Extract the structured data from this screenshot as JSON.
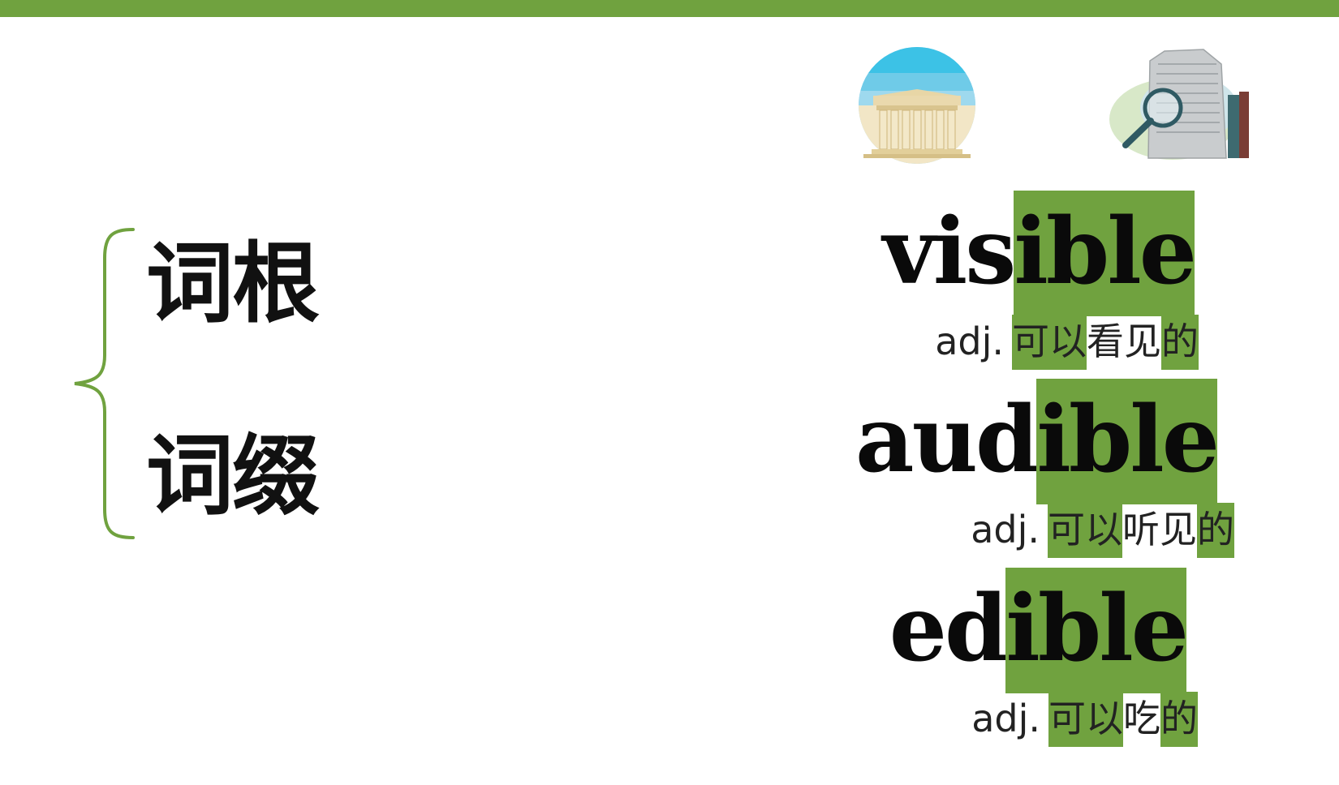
{
  "theme": {
    "accent": "#70a23f"
  },
  "left": {
    "root_term": "词根",
    "affix_term": "词缀"
  },
  "icons": {
    "first": "parthenon-temple-icon",
    "second": "inscribed-stone-tablet-with-magnifier-icon"
  },
  "words": [
    {
      "stem": "vis",
      "suffix": "ible",
      "pos": "adj.",
      "gloss_hl1": "可以",
      "gloss_mid": "看见",
      "gloss_hl2": "的"
    },
    {
      "stem": "aud",
      "suffix": "ible",
      "pos": "adj.",
      "gloss_hl1": "可以",
      "gloss_mid": "听见",
      "gloss_hl2": "的"
    },
    {
      "stem": "ed",
      "suffix": "ible",
      "pos": "adj.",
      "gloss_hl1": "可以",
      "gloss_mid": "吃",
      "gloss_hl2": "的"
    }
  ]
}
